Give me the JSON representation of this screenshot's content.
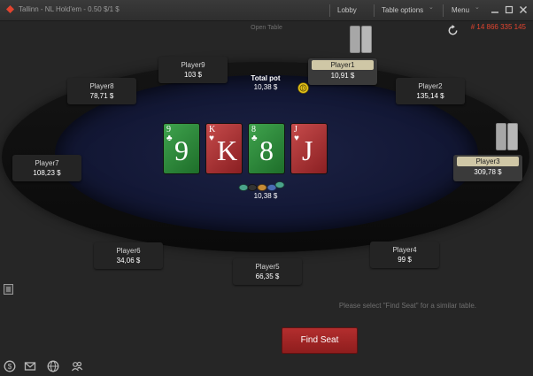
{
  "window": {
    "title": "Tallinn - NL Hold'em - 0.50 $/1 $",
    "lobby": "Lobby",
    "table_options": "Table options",
    "menu": "Menu"
  },
  "header": {
    "status": "Open Table",
    "table_id": "# 14 866 335 145"
  },
  "pot": {
    "label": "Total pot",
    "amount": "10,38 $",
    "chips_amount": "10,38 $"
  },
  "board": [
    {
      "rank": "9",
      "suit": "♣",
      "color": "green"
    },
    {
      "rank": "K",
      "suit": "♥",
      "color": "red"
    },
    {
      "rank": "8",
      "suit": "♣",
      "color": "green"
    },
    {
      "rank": "J",
      "suit": "♥",
      "color": "red"
    }
  ],
  "seats": [
    {
      "name": "Player1",
      "stack": "10,91 $"
    },
    {
      "name": "Player2",
      "stack": "135,14 $"
    },
    {
      "name": "Player3",
      "stack": "309,78 $"
    },
    {
      "name": "Player4",
      "stack": "99 $"
    },
    {
      "name": "Player5",
      "stack": "66,35 $"
    },
    {
      "name": "Player6",
      "stack": "34,06 $"
    },
    {
      "name": "Player7",
      "stack": "108,23 $"
    },
    {
      "name": "Player8",
      "stack": "78,71 $"
    },
    {
      "name": "Player9",
      "stack": "103 $"
    }
  ],
  "footer": {
    "hint": "Please select \"Find Seat\" for a similar table.",
    "find_seat": "Find Seat"
  },
  "colors": {
    "accent_red": "#e2442f",
    "felt": "#131836",
    "green_card": "#2f8a3c",
    "red_card": "#a82f31",
    "find_seat": "#a42626"
  },
  "icons": [
    "partypoker-logo-icon",
    "refresh-icon",
    "minimize-icon",
    "maximize-icon",
    "close-icon",
    "dealer-button-icon",
    "side-menu-icon",
    "cashier-icon",
    "mail-icon",
    "globe-icon",
    "players-icon"
  ]
}
